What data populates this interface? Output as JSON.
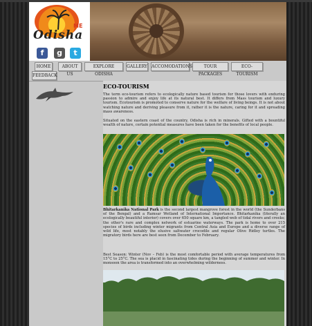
{
  "header": {
    "logo_text": "Odisha",
    "logo_sub": "ME",
    "social_icons": [
      "facebook-icon",
      "google-plus-icon",
      "twitter-icon"
    ]
  },
  "nav": {
    "items": [
      "HOME",
      "ABOUT US",
      "EXPLORE ODISHA",
      "GALLERY",
      "ACCOMODATIONS",
      "TOUR PACKAGES",
      "ECO-TOURISM",
      "FEEDBACK"
    ]
  },
  "main": {
    "title": "ECO-TOURISM",
    "intro": "The term eco-tourism refers to ecologically nature based tourism for those lovers with enduring passion to admire and enjoy life at its natural best. It differs from Mass tourism and luxury tourism. Ecotourism is promoted to conserve nature for the welfare of living beings. It is not about watching nature and deriving pleasure from it, rather it is the nature, caring for it and spreading mass awareness.",
    "intro2": "Situated on the eastern coast of the country, Odisha is rich in minerals. Gifted with a bountiful wealth of nature, certain potential measures have been taken for the benefits of local people.",
    "park_name": "Bhitarkanika National Park",
    "park_text": " is the second largest mangrove forest in the world (the Sunderbans of the Bengal) and a Ramsar Wetland of International Importance. Bhitarkanika (literally an ecologically beautiful interior) covers over 650 square km, a tangled web of tidal rivers and creeks; the other's rare and complex network of estuarine waterways. The park is home to over 215 species of birds including winter migrants from Central Asia and Europe and a diverse range of wild life, most notably the elusive saltwater crocodile and regular Olive Ridley turtles. The migratory birds here are best seen from December to February.",
    "season": "Best Season: Winter (Nov – Feb) is the most comfortable period with average temperatures from 15°C to 25°C. The sea is placid in fascinating tides during the beginning of summer and winter. In monsoon the area is transformed into an overwhelming wilderness."
  }
}
